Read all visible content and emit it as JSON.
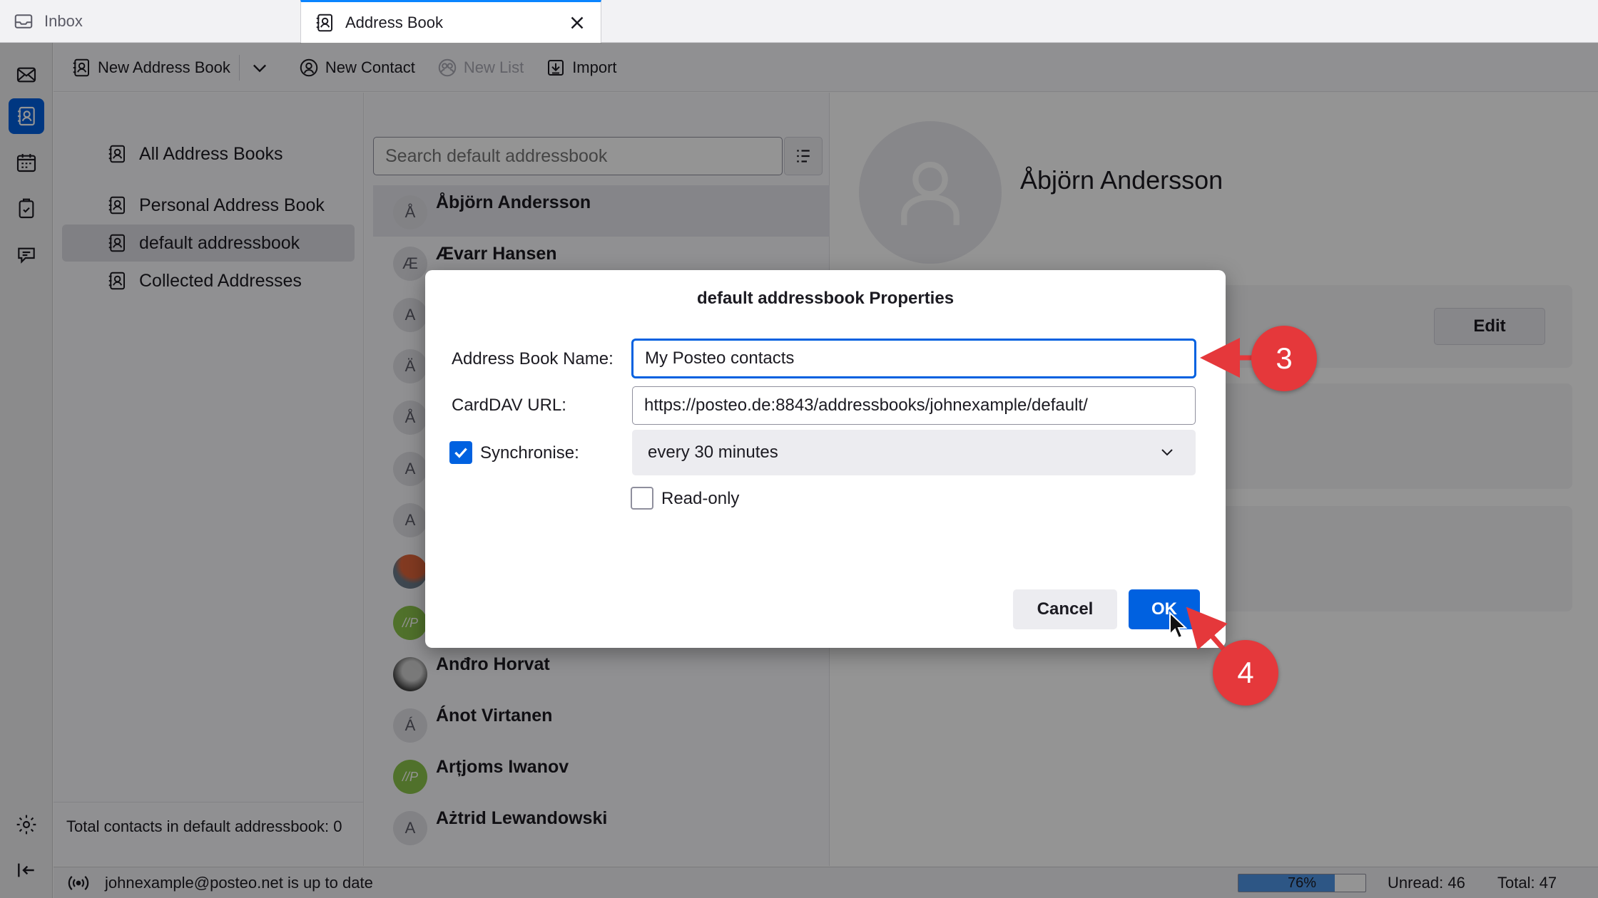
{
  "tabs": [
    {
      "label": "Inbox",
      "icon": "inbox-icon"
    },
    {
      "label": "Address Book",
      "icon": "address-book-icon",
      "active": true
    }
  ],
  "toolbar": {
    "new_address_book": "New Address Book",
    "new_contact": "New Contact",
    "new_list": "New List",
    "import": "Import"
  },
  "address_books": {
    "all": "All Address Books",
    "items": [
      "Personal Address Book",
      "default addressbook",
      "Collected Addresses"
    ],
    "selected": "default addressbook",
    "footer": "Total contacts in default addressbook: 0"
  },
  "contacts": {
    "search_placeholder": "Search default addressbook",
    "list": [
      {
        "initial": "Å",
        "name": "Åbjörn Andersson"
      },
      {
        "initial": "Æ",
        "name": "Ævarr Hansen"
      },
      {
        "initial": "A",
        "name": ""
      },
      {
        "initial": "Ä",
        "name": ""
      },
      {
        "initial": "Å",
        "name": ""
      },
      {
        "initial": "A",
        "name": ""
      },
      {
        "initial": "A",
        "name": ""
      },
      {
        "initial": "",
        "name": ""
      },
      {
        "initial": "//P",
        "name": ""
      },
      {
        "initial": "",
        "name": "Anđro Horvat"
      },
      {
        "initial": "Á",
        "name": "Ánot Virtanen"
      },
      {
        "initial": "//P",
        "name": "Arțjoms Iwanov"
      },
      {
        "initial": "A",
        "name": "Ażtrid Lewandowski"
      }
    ]
  },
  "detail": {
    "name": "Åbjörn Andersson",
    "edit_label": "Edit"
  },
  "dialog": {
    "title": "default addressbook Properties",
    "name_label": "Address Book Name:",
    "name_value": "My Posteo contacts",
    "url_label": "CardDAV URL:",
    "url_value": "https://posteo.de:8843/addressbooks/johnexample/default/",
    "sync_label": "Synchronise:",
    "sync_checked": true,
    "sync_interval": "every 30 minutes",
    "readonly_label": "Read-only",
    "readonly_checked": false,
    "cancel_label": "Cancel",
    "ok_label": "OK"
  },
  "callouts": {
    "step3": "3",
    "step4": "4"
  },
  "status": {
    "message": "johnexample@posteo.net is up to date",
    "progress_percent": 76,
    "progress_label": "76%",
    "unread": "Unread: 46",
    "total": "Total: 47"
  },
  "colors": {
    "accent": "#0061e0",
    "callout": "#e5383b"
  }
}
